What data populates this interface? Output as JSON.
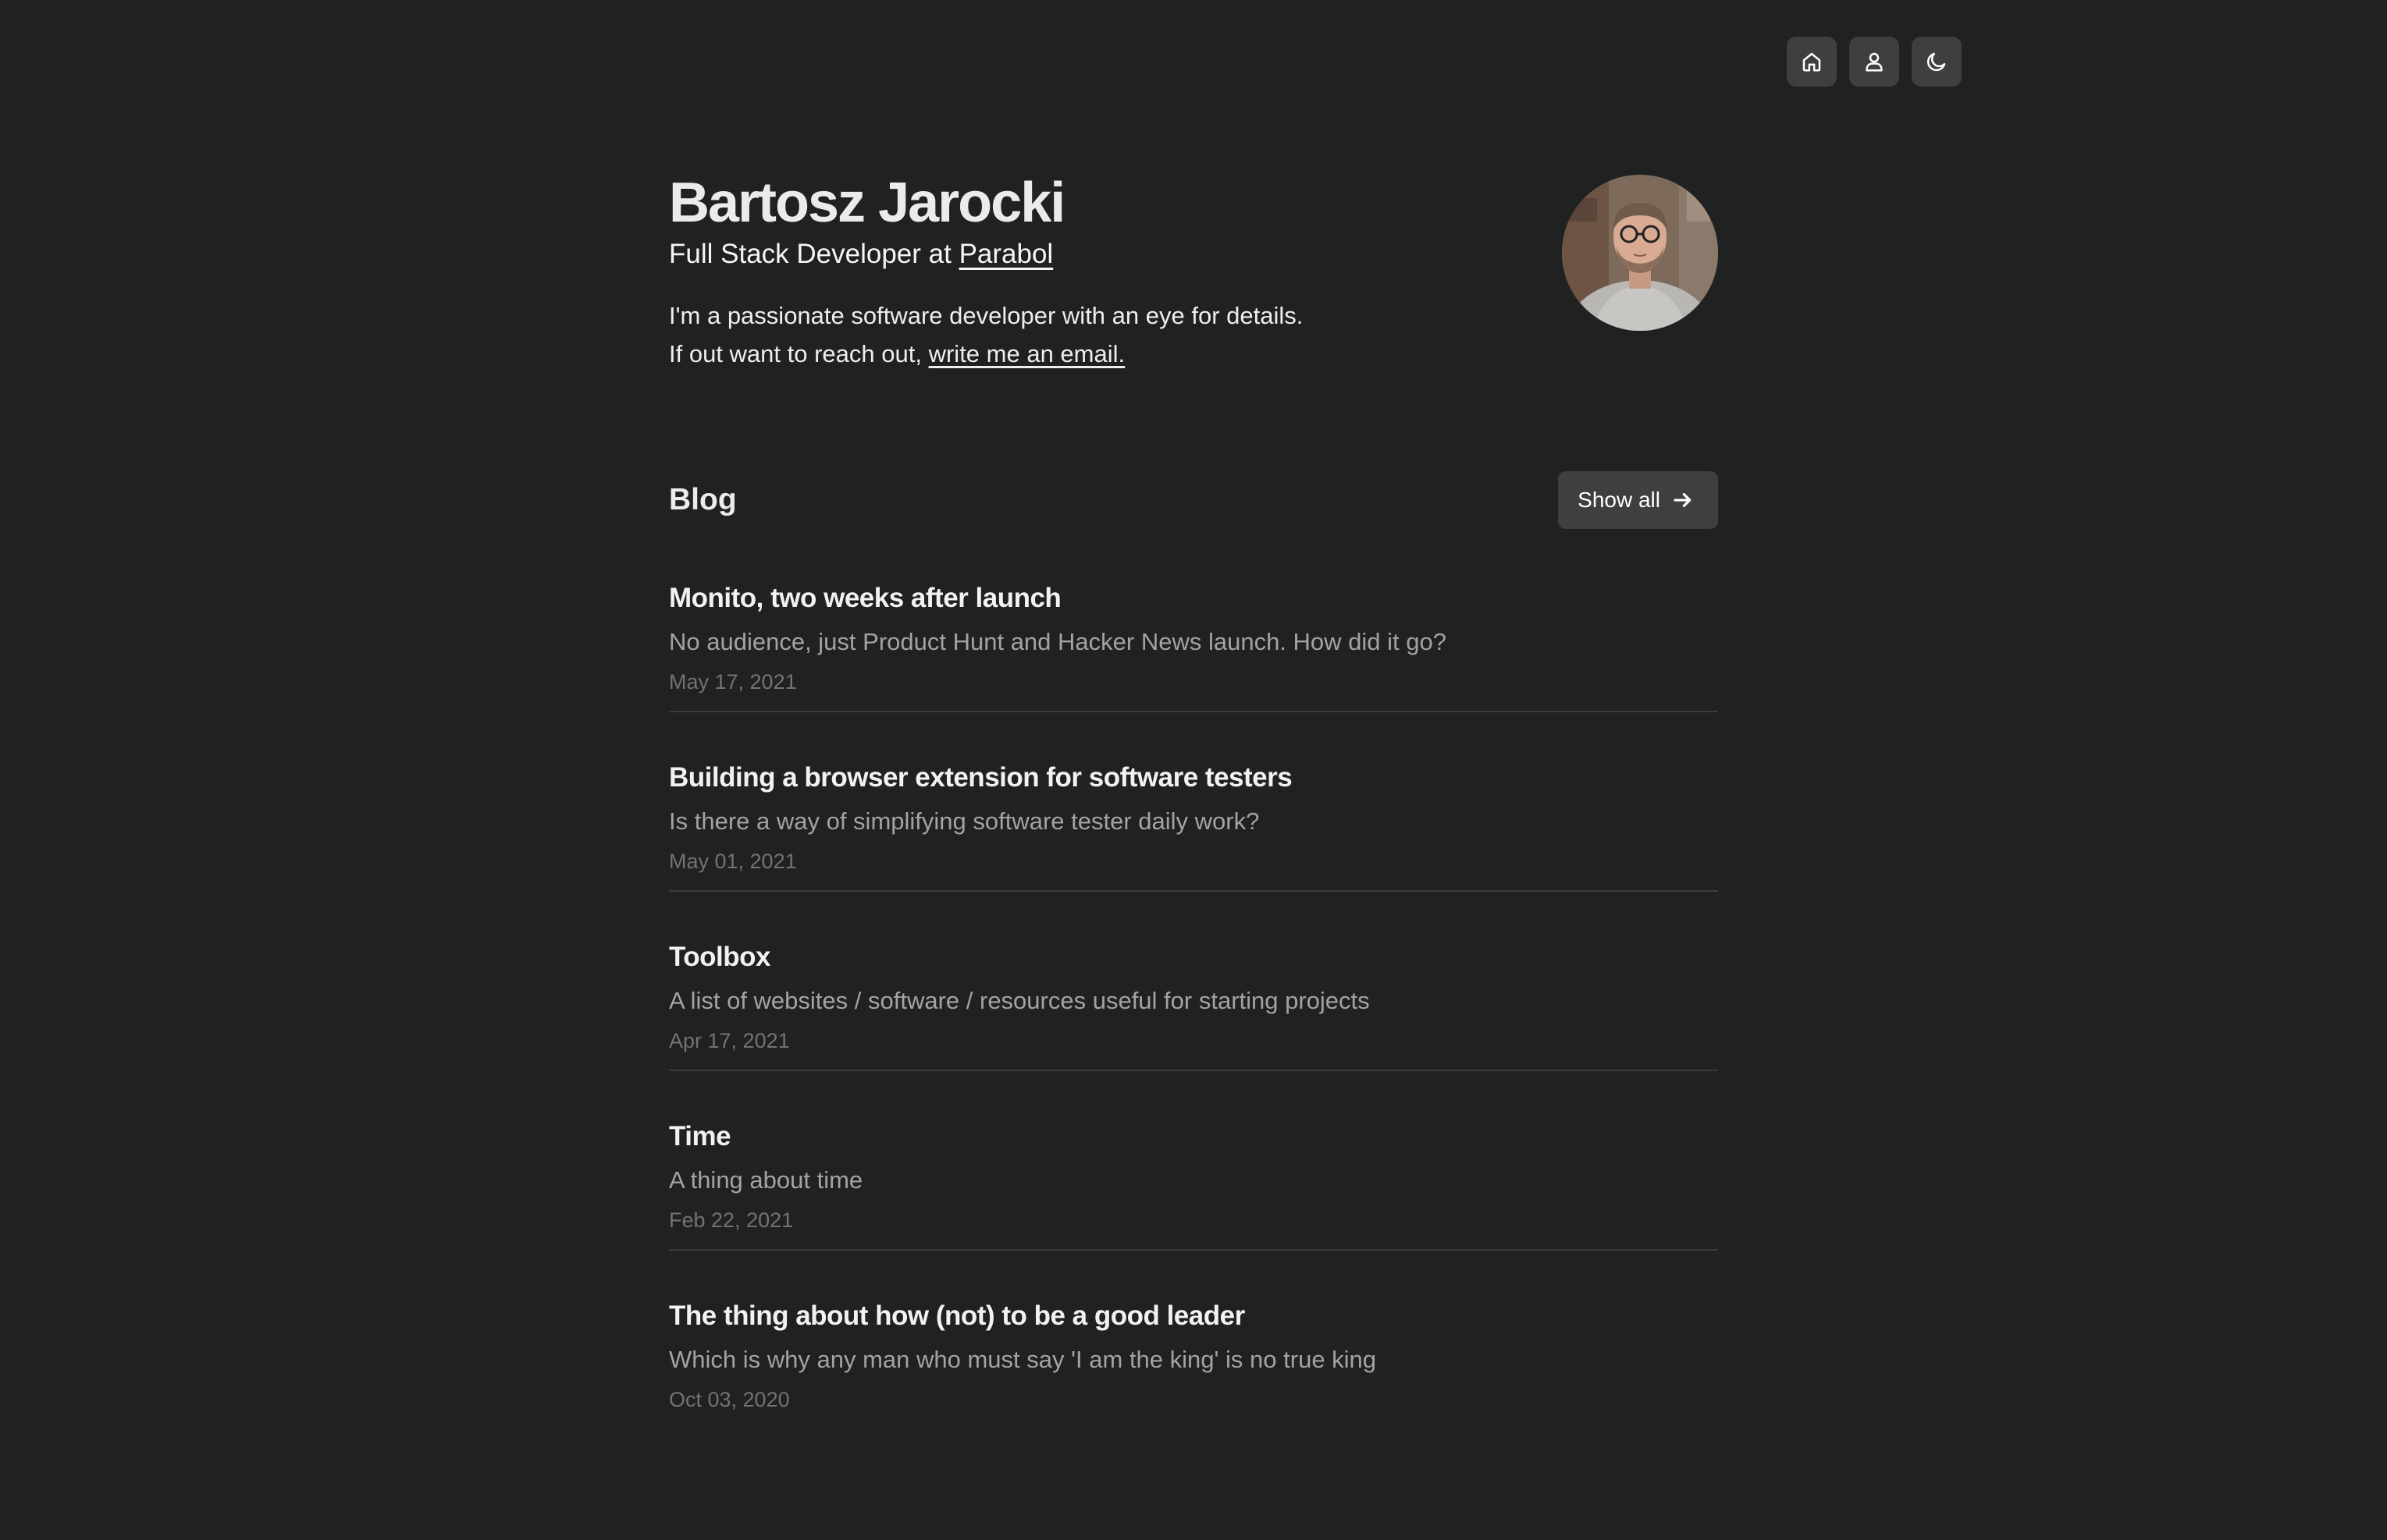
{
  "nav": {
    "buttons": [
      {
        "icon": "home-icon"
      },
      {
        "icon": "user-icon"
      },
      {
        "icon": "moon-icon"
      }
    ]
  },
  "hero": {
    "name": "Bartosz Jarocki",
    "role_prefix": "Full Stack Developer at ",
    "company": "Parabol",
    "bio_line1": "I'm a passionate software developer with an eye for details.",
    "bio_line2_prefix": "If out want to reach out, ",
    "email_link": "write me an email."
  },
  "blog": {
    "title": "Blog",
    "show_all_label": "Show all",
    "posts": [
      {
        "title": "Monito, two weeks after launch",
        "description": "No audience, just Product Hunt and Hacker News launch. How did it go?",
        "date": "May 17, 2021"
      },
      {
        "title": "Building a browser extension for software testers",
        "description": "Is there a way of simplifying software tester daily work?",
        "date": "May 01, 2021"
      },
      {
        "title": "Toolbox",
        "description": "A list of websites / software / resources useful for starting projects",
        "date": "Apr 17, 2021"
      },
      {
        "title": "Time",
        "description": "A thing about time",
        "date": "Feb 22, 2021"
      },
      {
        "title": "The thing about how (not) to be a good leader",
        "description": "Which is why any man who must say 'I am the king' is no true king",
        "date": "Oct 03, 2020"
      }
    ]
  },
  "colors": {
    "background": "#202121",
    "button_bg": "#3f3f42",
    "text_primary": "#ebebeb",
    "text_secondary": "#a3a3a3",
    "text_muted": "#737373",
    "divider": "#3d3d3d"
  }
}
